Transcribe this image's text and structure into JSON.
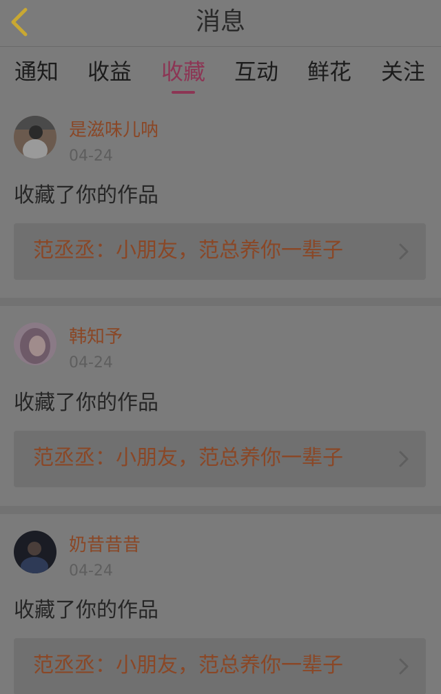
{
  "header": {
    "title": "消息",
    "back_icon": "chevron-left-icon",
    "accent": "#c9a832"
  },
  "tabs": [
    {
      "label": "通知",
      "active": false
    },
    {
      "label": "收益",
      "active": false
    },
    {
      "label": "收藏",
      "active": true
    },
    {
      "label": "互动",
      "active": false
    },
    {
      "label": "鲜花",
      "active": false
    },
    {
      "label": "关注",
      "active": false
    }
  ],
  "messages": [
    {
      "username": "是滋味儿呐",
      "date": "04-24",
      "action": "收藏了你的作品",
      "work_title": "范丞丞：小朋友，范总养你一辈子",
      "chevron_icon": "chevron-right-icon"
    },
    {
      "username": "韩知予",
      "date": "04-24",
      "action": "收藏了你的作品",
      "work_title": "范丞丞：小朋友，范总养你一辈子",
      "chevron_icon": "chevron-right-icon"
    },
    {
      "username": "奶昔昔昔",
      "date": "04-24",
      "action": "收藏了你的作品",
      "work_title": "范丞丞：小朋友，范总养你一辈子",
      "chevron_icon": "chevron-right-icon"
    }
  ],
  "colors": {
    "active_tab": "#8c3554",
    "username": "#8a4726",
    "work_title": "#8a4726"
  }
}
